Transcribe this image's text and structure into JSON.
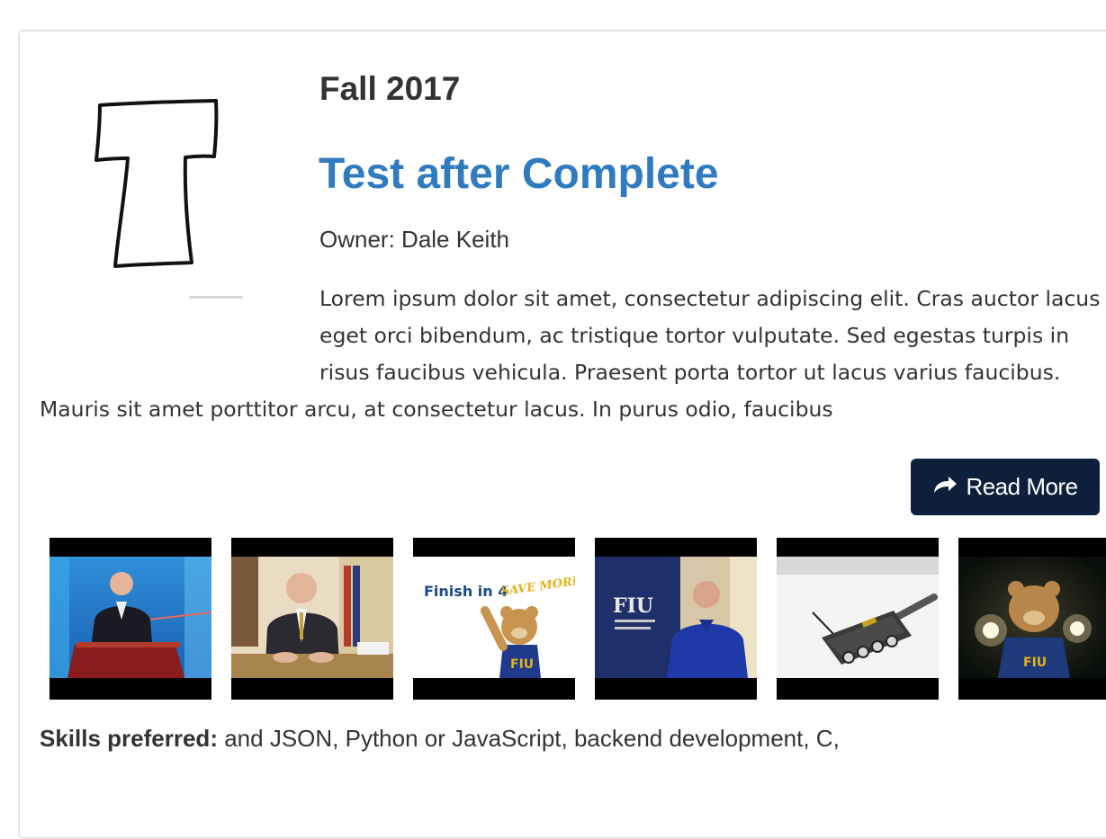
{
  "project": {
    "term": "Fall 2017",
    "title": "Test after Complete",
    "owner_label": "Owner:",
    "owner_name": "Dale Keith",
    "description": "Lorem ipsum dolor sit amet, consectetur adipiscing elit. Cras auctor lacus eget orci bibendum, ac tristique tortor vulputate. Sed egestas turpis in risus faucibus vehicula. Praesent porta tortor ut lacus varius faucibus. Mauris sit amet porttitor arcu, at consectetur lacus. In purus odio, faucibus",
    "read_more_label": "Read More",
    "read_more_icon": "share-arrow-icon",
    "skills_label": "Skills preferred:",
    "skills_value": "and JSON, Python or JavaScript, backend development, C,"
  },
  "logo": {
    "icon": "hand-drawn-letter-t-logo"
  },
  "videos": [
    {
      "name": "video-thumbnail-speaker-podium"
    },
    {
      "name": "video-thumbnail-official-desk"
    },
    {
      "name": "video-thumbnail-finish-in-4",
      "overlay_text": "Finish in 4",
      "overlay_text_2": "SAVE MORE"
    },
    {
      "name": "video-thumbnail-fiu-interview",
      "overlay_text": "FIU"
    },
    {
      "name": "video-thumbnail-robot-device"
    },
    {
      "name": "video-thumbnail-mascot",
      "overlay_text": "FIU"
    }
  ],
  "colors": {
    "title": "#2f7bbf",
    "button_bg": "#0e1f3c",
    "text": "#333333",
    "card_border": "#e2e2e2"
  }
}
